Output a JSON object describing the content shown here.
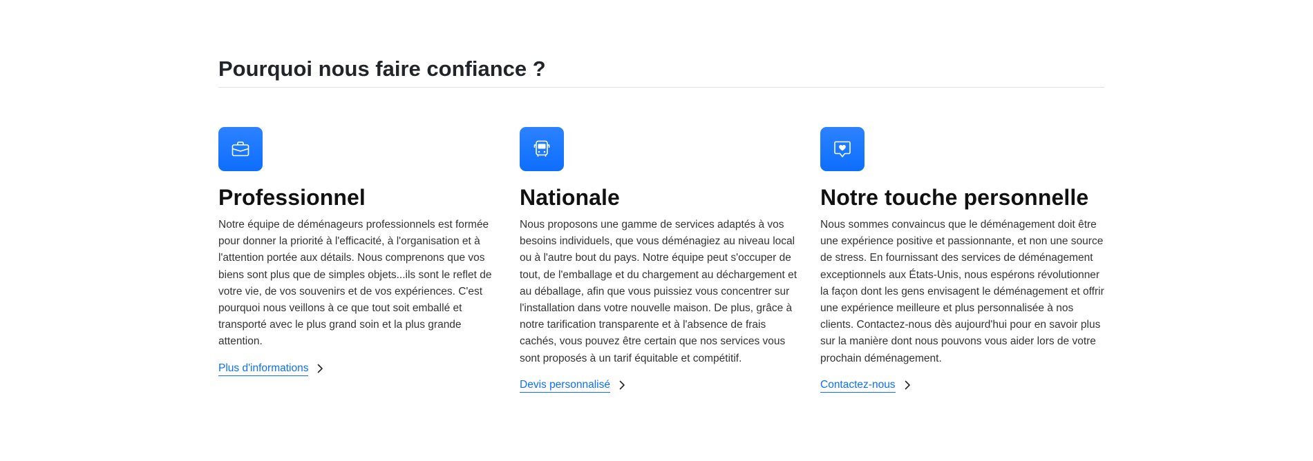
{
  "section": {
    "title": "Pourquoi nous faire confiance ?"
  },
  "colors": {
    "accent": "#0d6efd",
    "icon_bg": "#2c82ff",
    "text": "#333333",
    "heading": "#111111",
    "rule": "#dee2e6"
  },
  "features": [
    {
      "icon": "briefcase-icon",
      "title": "Professionnel",
      "text": "Notre équipe de déménageurs professionnels est formée pour donner la priorité à l'efficacité, à l'organisation et à l'attention portée aux détails. Nous comprenons que vos biens sont plus que de simples objets...ils sont le reflet de votre vie, de vos souvenirs et de vos expériences. C'est pourquoi nous veillons à ce que tout soit emballé et transporté avec le plus grand soin et la plus grande attention.",
      "link": "Plus d'informations"
    },
    {
      "icon": "bus-icon",
      "title": "Nationale",
      "text": "Nous proposons une gamme de services adaptés à vos besoins individuels, que vous déménagiez au niveau local ou à l'autre bout du pays. Notre équipe peut s'occuper de tout, de l'emballage et du chargement au déchargement et au déballage, afin que vous puissiez vous concentrer sur l'installation dans votre nouvelle maison. De plus, grâce à notre tarification transparente et à l'absence de frais cachés, vous pouvez être certain que nos services vous sont proposés à un tarif équitable et compétitif.",
      "link": "Devis personnalisé"
    },
    {
      "icon": "chat-heart-icon",
      "title": "Notre touche personnelle",
      "text": "Nous sommes convaincus que le déménagement doit être une expérience positive et passionnante, et non une source de stress. En fournissant des services de déménagement exceptionnels aux États-Unis, nous espérons révolutionner la façon dont les gens envisagent le déménagement et offrir une expérience meilleure et plus personnalisée à nos clients. Contactez-nous dès aujourd'hui pour en savoir plus sur la manière dont nous pouvons vous aider lors de votre prochain déménagement.",
      "link": "Contactez-nous"
    }
  ]
}
